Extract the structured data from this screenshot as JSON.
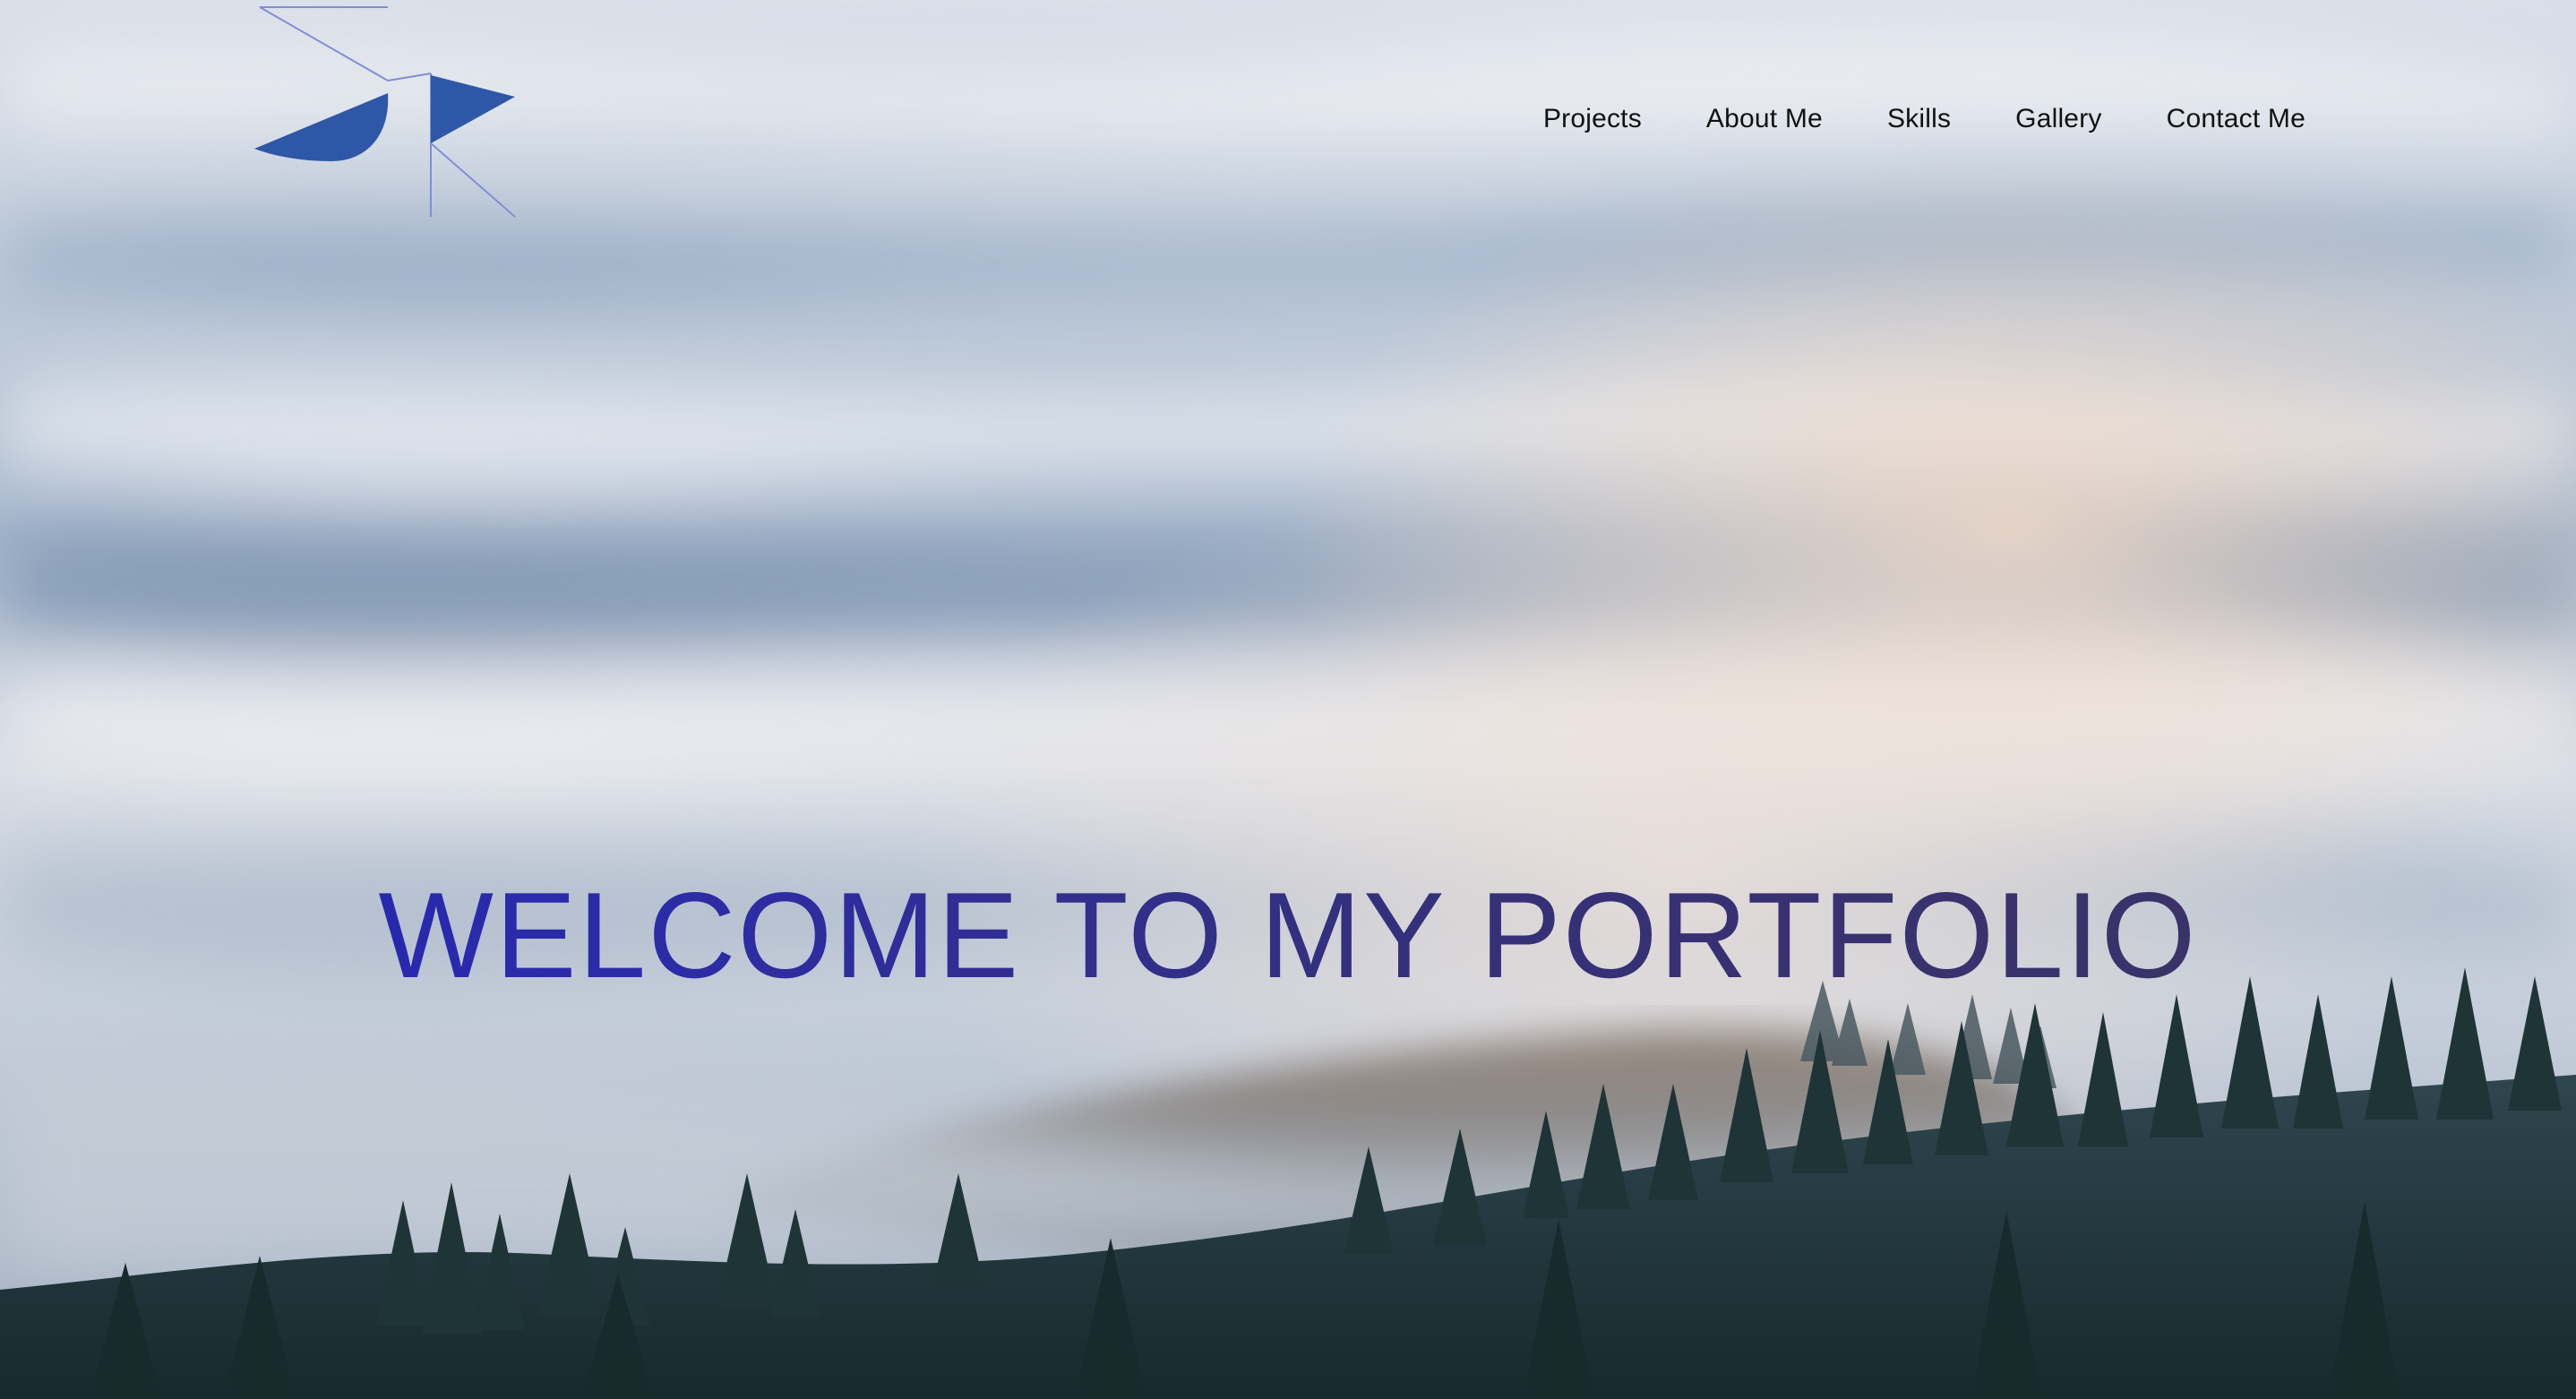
{
  "logo": {
    "icon": "jr-geometric-logo-icon",
    "colors": {
      "fill": "#2f57a8",
      "stroke": "#7f8fd6"
    }
  },
  "nav": {
    "items": [
      {
        "label": "Projects"
      },
      {
        "label": "About Me"
      },
      {
        "label": "Skills"
      },
      {
        "label": "Gallery"
      },
      {
        "label": "Contact Me"
      }
    ]
  },
  "hero": {
    "title": "WELCOME TO MY PORTFOLIO",
    "background": "foggy-forest-landscape",
    "title_colors": [
      "#2323b8",
      "#3d3460"
    ]
  }
}
